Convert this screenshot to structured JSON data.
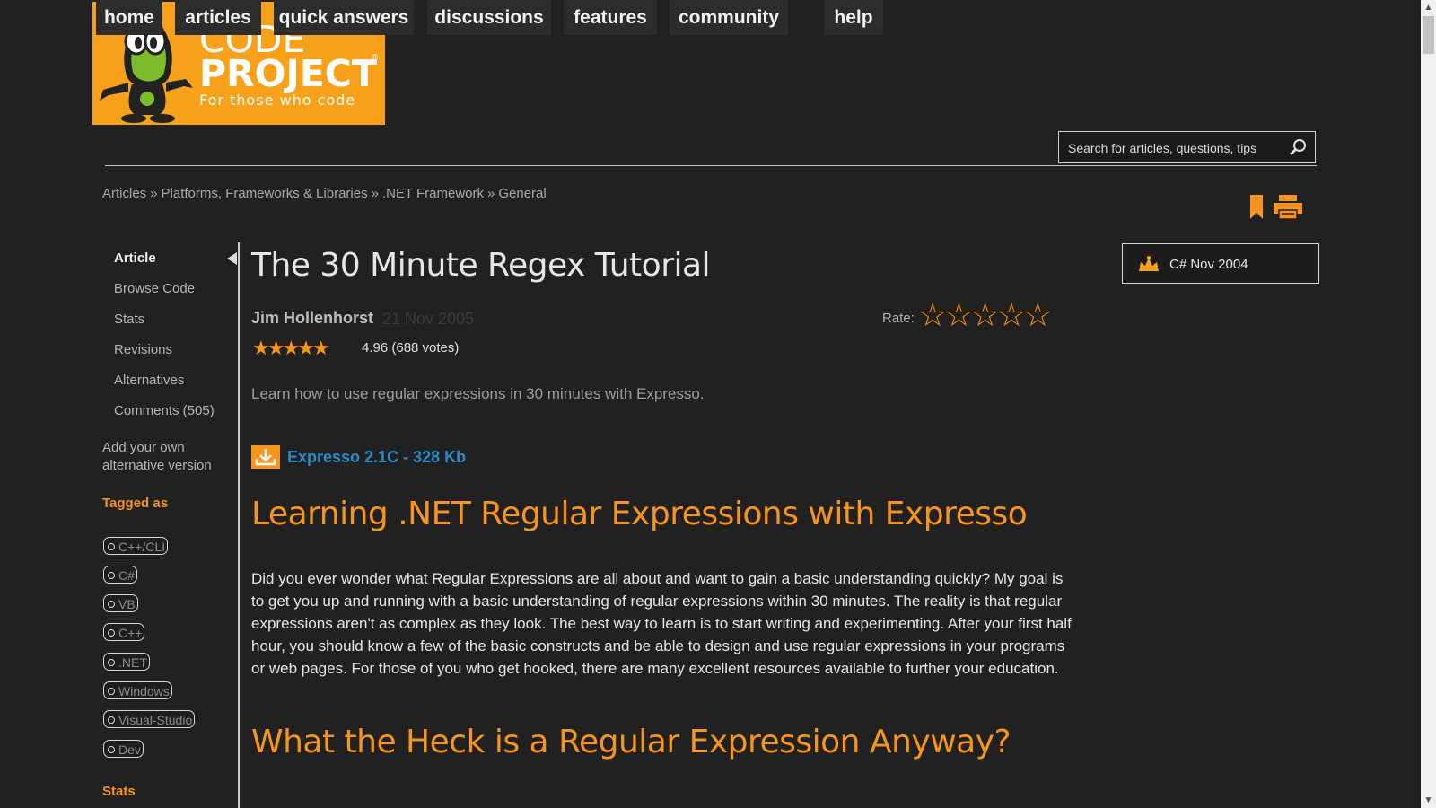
{
  "logo": {
    "line1": "CODE",
    "line2": "PROJECT",
    "tagline": "For those who code",
    "registered": "®"
  },
  "nav": [
    {
      "label": "home"
    },
    {
      "label": "articles"
    },
    {
      "label": "quick answers"
    },
    {
      "label": "discussions"
    },
    {
      "label": "features"
    },
    {
      "label": "community"
    },
    {
      "label": "help"
    }
  ],
  "search": {
    "placeholder": "Search for articles, questions, tips",
    "icon": "magnifier-icon"
  },
  "breadcrumb": {
    "items": [
      "Articles",
      "Platforms, Frameworks & Libraries",
      ".NET Framework",
      "General"
    ],
    "separator": "»"
  },
  "sidebar": {
    "links": [
      "Article",
      "Browse Code",
      "Stats",
      "Revisions",
      "Alternatives",
      "Comments (505)"
    ],
    "add_alternative": "Add your own alternative version",
    "tagged_heading": "Tagged as",
    "tags": [
      "C++/CLI",
      "C#",
      "VB",
      "C++",
      ".NET",
      "Windows",
      "Visual-Studio",
      "Dev"
    ],
    "stats_heading": "Stats"
  },
  "article": {
    "title": "The 30 Minute Regex Tutorial",
    "author": "Jim Hollenhorst",
    "date": "21 Nov 2005",
    "stars": "★★★★★",
    "rating_text": "4.96 (688 votes)",
    "rating_value": 4.96,
    "rate_label": "Rate:",
    "rate_stars": "☆☆☆☆☆",
    "summary": "Learn how to use regular expressions in 30 minutes with Expresso.",
    "download_label": "Expresso 2.1C - 328 Kb",
    "heading1": "Learning .NET Regular Expressions with Expresso",
    "paragraph1": "Did you ever wonder what Regular Expressions are all about and want to gain a basic understanding quickly? My goal is to get you up and running with a basic understanding of regular expressions within 30 minutes. The reality is that regular expressions aren't as complex as they look. The best way to learn is to start writing and experimenting. After your first half hour, you should know a few of the basic constructs and be able to design and use regular expressions in your programs or web pages. For those of you who get hooked, there are many excellent resources available to further your education.",
    "heading2": "What the Heck is a Regular Expression Anyway?"
  },
  "award": {
    "label": "C# Nov 2004"
  },
  "colors": {
    "accent": "#f7941d",
    "link": "#2e88c5",
    "background": "#212121"
  }
}
